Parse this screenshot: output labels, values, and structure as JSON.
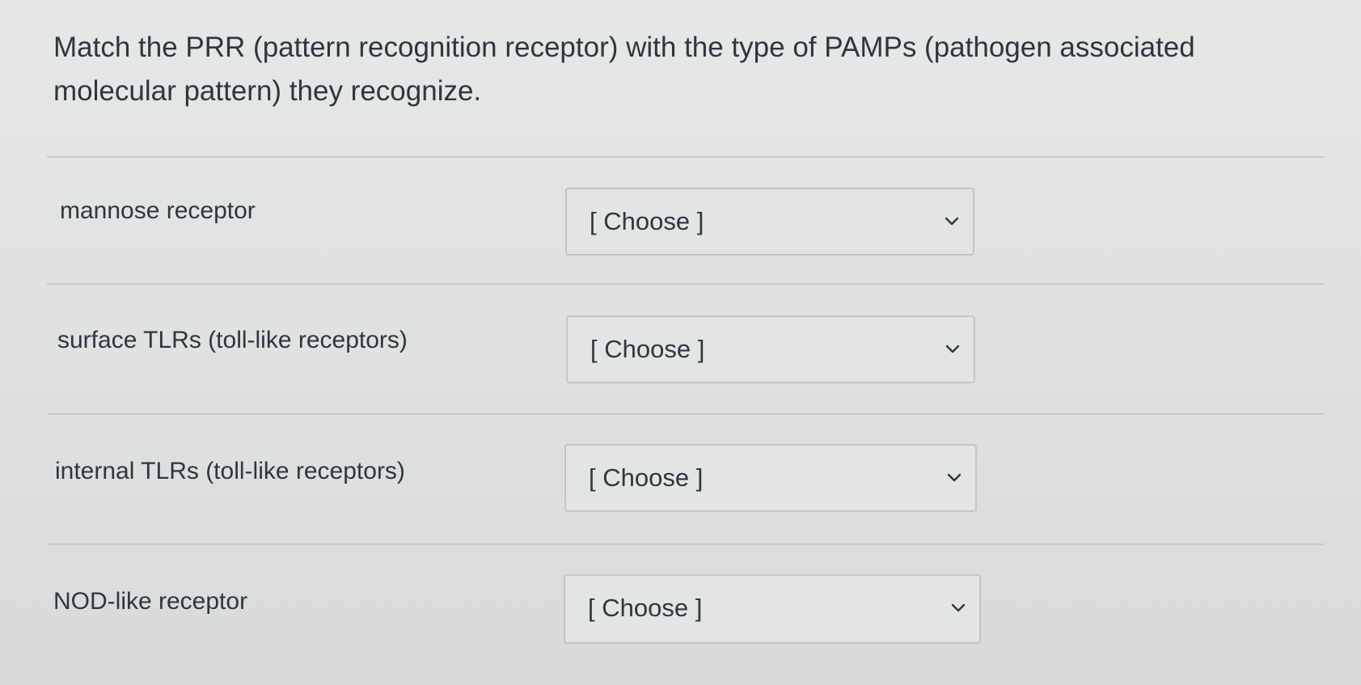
{
  "question": {
    "text": "Match the PRR (pattern recognition receptor) with the type of PAMPs (pathogen associated molecular pattern) they recognize."
  },
  "matches": [
    {
      "label": "mannose receptor",
      "selected": "[ Choose ]"
    },
    {
      "label": "surface TLRs (toll-like receptors)",
      "selected": "[ Choose ]"
    },
    {
      "label": "internal TLRs (toll-like receptors)",
      "selected": "[ Choose ]"
    },
    {
      "label": "NOD-like receptor",
      "selected": "[ Choose ]"
    }
  ],
  "icons": {
    "dropdown": "chevron-down-icon"
  },
  "colors": {
    "text": "#2b3740",
    "border": "#c3c6c5",
    "background": "#e2e4e3"
  }
}
